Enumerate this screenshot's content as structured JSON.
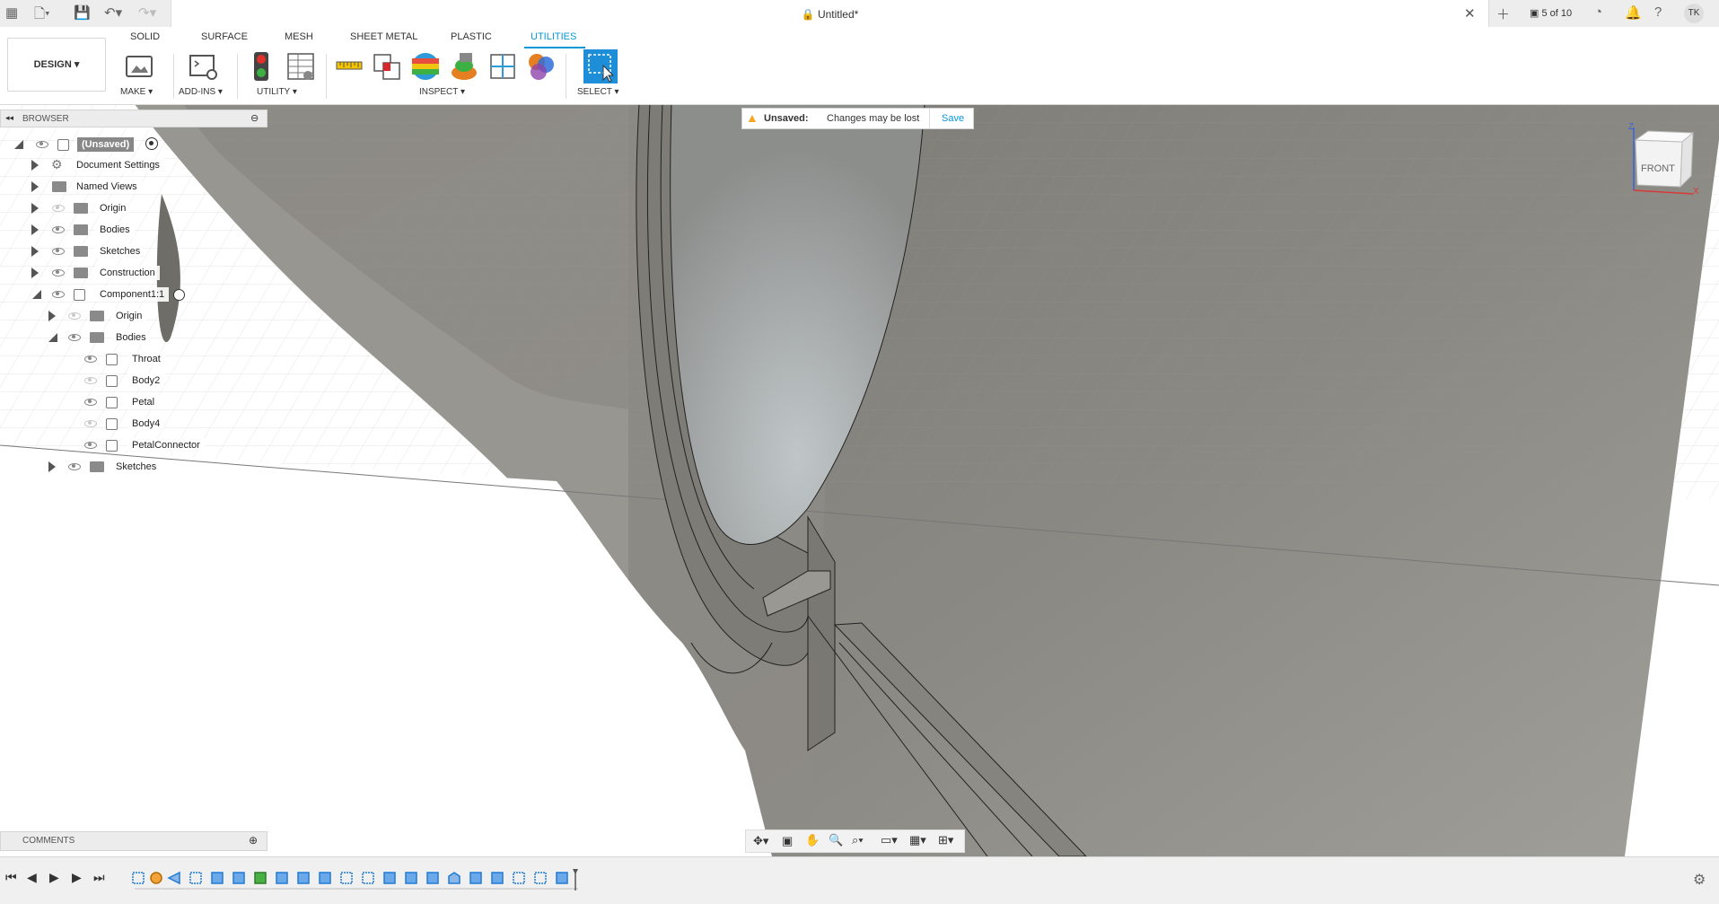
{
  "titlebar": {
    "doc_title": "Untitled*",
    "page_counter": "5 of 10",
    "user_initials": "TK"
  },
  "ribbon": {
    "workspace": "DESIGN",
    "tabs": [
      {
        "label": "SOLID",
        "active": false
      },
      {
        "label": "SURFACE",
        "active": false
      },
      {
        "label": "MESH",
        "active": false
      },
      {
        "label": "SHEET METAL",
        "active": false
      },
      {
        "label": "PLASTIC",
        "active": false
      },
      {
        "label": "UTILITIES",
        "active": true
      }
    ],
    "groups": {
      "make": "MAKE",
      "addins": "ADD-INS",
      "utility": "UTILITY",
      "inspect": "INSPECT",
      "select": "SELECT"
    }
  },
  "browser": {
    "title": "BROWSER",
    "root_label": "(Unsaved)",
    "nodes": [
      {
        "label": "Document Settings",
        "icon": "gear-icon"
      },
      {
        "label": "Named Views",
        "icon": "folder-icon"
      },
      {
        "label": "Origin",
        "icon": "folder-icon",
        "eye_hidden": true
      },
      {
        "label": "Bodies",
        "icon": "folder-icon"
      },
      {
        "label": "Sketches",
        "icon": "folder-icon"
      },
      {
        "label": "Construction",
        "icon": "folder-icon"
      },
      {
        "label": "Component1:1",
        "icon": "component-icon"
      },
      {
        "label": "Origin",
        "icon": "folder-icon",
        "eye_hidden": true
      },
      {
        "label": "Bodies",
        "icon": "folder-icon"
      },
      {
        "label": "Throat",
        "icon": "body-icon"
      },
      {
        "label": "Body2",
        "icon": "body-icon",
        "eye_hidden": true
      },
      {
        "label": "Petal",
        "icon": "body-icon"
      },
      {
        "label": "Body4",
        "icon": "body-icon",
        "eye_hidden": true
      },
      {
        "label": "PetalConnector",
        "icon": "body-icon"
      },
      {
        "label": "Sketches",
        "icon": "folder-icon"
      }
    ]
  },
  "notice": {
    "title": "Unsaved:",
    "message": "Changes may be lost",
    "action": "Save"
  },
  "comments": {
    "title": "COMMENTS"
  },
  "viewcube": {
    "face": "FRONT",
    "axis_z": "Z",
    "axis_x": "X"
  },
  "colors": {
    "accent": "#0696d7",
    "model_surface": "#8f8d86",
    "warning": "#f5a623"
  }
}
